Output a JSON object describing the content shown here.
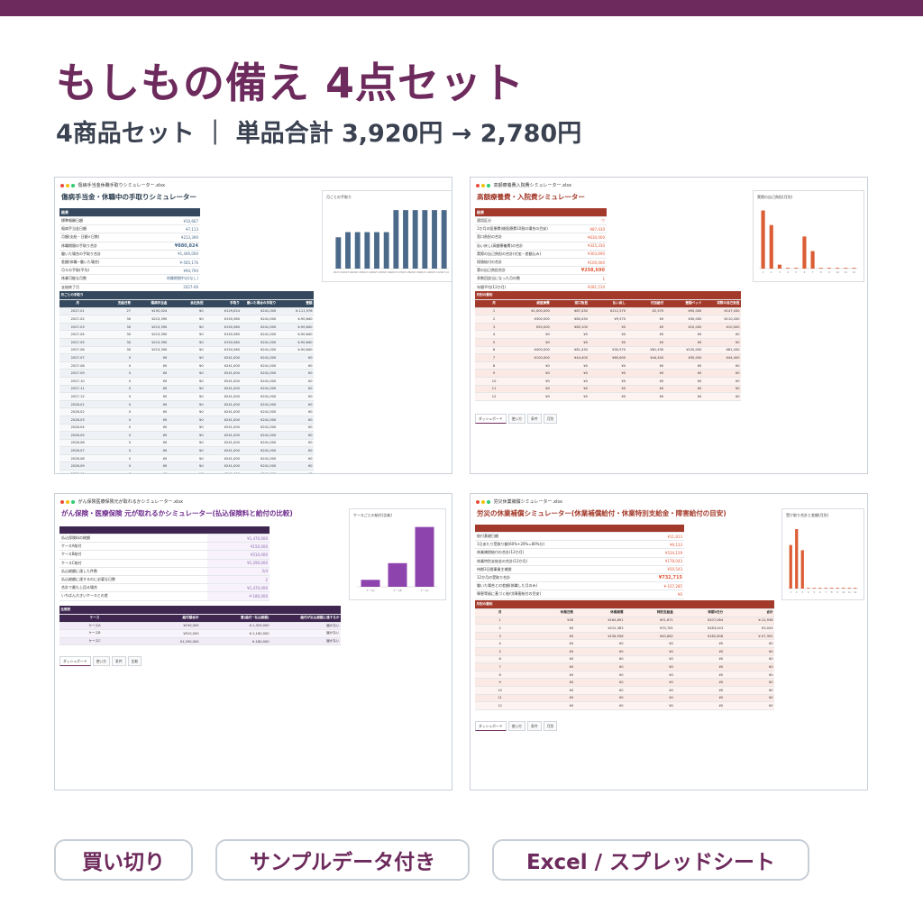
{
  "header": {
    "title": "もしもの備え 4点セット",
    "subtitle": "4商品セット ｜ 単品合計 3,920円 → 2,780円"
  },
  "colors": {
    "brand": "#6d2a5c",
    "navy": "#34495e",
    "brick": "#a3392a",
    "bar_blue": "#4b6a8a",
    "bar_orange": "#dc5c34",
    "purple_dark": "#3e2650",
    "purple_bar": "#8e44ad"
  },
  "tags": [
    "買い切り",
    "サンプルデータ付き",
    "Excel / スプレッドシート"
  ],
  "cards": [
    {
      "file": "傷病手当金休職手取りシミュレーター.xlsx",
      "sheet_title": "傷病手当金・休職中の手取りシミュレーター",
      "summary_label": "結果",
      "kpis": [
        [
          "標準報酬日額",
          "¥10,667"
        ],
        [
          "傷病手当金日額",
          "¥7,113"
        ],
        [
          "月額(支給・日額×日数)",
          "¥213,390"
        ],
        [
          "休職期間の手取り合計",
          "¥880,824"
        ],
        [
          "働いた場合の手取り合計",
          "¥1,446,000"
        ],
        [
          "差額(休職−働いた場合)",
          "¥-565,176"
        ],
        [
          "月々の手取(平均)",
          "¥94,794"
        ],
        [
          "休業可能な月数",
          "休職期間中は(なし)"
        ],
        [
          "支給終了月",
          "2027-06"
        ]
      ],
      "table_label": "月ごとの手取り",
      "columns": [
        "月",
        "支給日数",
        "傷病手当金",
        "会社負担",
        "手取り",
        "働いた場合の手取り",
        "差額"
      ],
      "rows": [
        [
          "2027-01",
          "27",
          "¥192,024",
          "¥0",
          "¥129,024",
          "¥241,000",
          "¥-111,976"
        ],
        [
          "2027-02",
          "30",
          "¥213,390",
          "¥0",
          "¥150,360",
          "¥241,000",
          "¥-90,640"
        ],
        [
          "2027-03",
          "30",
          "¥213,390",
          "¥0",
          "¥150,360",
          "¥241,000",
          "¥-90,640"
        ],
        [
          "2027-04",
          "30",
          "¥213,390",
          "¥0",
          "¥150,360",
          "¥241,000",
          "¥-90,640"
        ],
        [
          "2027-05",
          "30",
          "¥213,390",
          "¥0",
          "¥150,360",
          "¥241,000",
          "¥-90,640"
        ],
        [
          "2027-06",
          "30",
          "¥213,390",
          "¥0",
          "¥150,360",
          "¥241,000",
          "¥-90,640"
        ],
        [
          "2027-07",
          "0",
          "¥0",
          "¥0",
          "¥241,000",
          "¥241,000",
          "¥0"
        ],
        [
          "2027-08",
          "0",
          "¥0",
          "¥0",
          "¥241,000",
          "¥241,000",
          "¥0"
        ],
        [
          "2027-09",
          "0",
          "¥0",
          "¥0",
          "¥241,000",
          "¥241,000",
          "¥0"
        ],
        [
          "2027-10",
          "0",
          "¥0",
          "¥0",
          "¥241,000",
          "¥241,000",
          "¥0"
        ],
        [
          "2027-11",
          "0",
          "¥0",
          "¥0",
          "¥241,000",
          "¥241,000",
          "¥0"
        ],
        [
          "2027-12",
          "0",
          "¥0",
          "¥0",
          "¥241,000",
          "¥241,000",
          "¥0"
        ],
        [
          "2028-01",
          "0",
          "¥0",
          "¥0",
          "¥241,000",
          "¥241,000",
          "¥0"
        ],
        [
          "2028-02",
          "0",
          "¥0",
          "¥0",
          "¥241,000",
          "¥241,000",
          "¥0"
        ],
        [
          "2028-03",
          "0",
          "¥0",
          "¥0",
          "¥241,000",
          "¥241,000",
          "¥0"
        ],
        [
          "2028-04",
          "0",
          "¥0",
          "¥0",
          "¥241,000",
          "¥241,000",
          "¥0"
        ],
        [
          "2028-05",
          "0",
          "¥0",
          "¥0",
          "¥241,000",
          "¥241,000",
          "¥0"
        ],
        [
          "2028-06",
          "0",
          "¥0",
          "¥0",
          "¥241,000",
          "¥241,000",
          "¥0"
        ],
        [
          "2028-07",
          "0",
          "¥0",
          "¥0",
          "¥241,000",
          "¥241,000",
          "¥0"
        ],
        [
          "2028-08",
          "0",
          "¥0",
          "¥0",
          "¥241,000",
          "¥241,000",
          "¥0"
        ],
        [
          "2028-09",
          "0",
          "¥0",
          "¥0",
          "¥241,000",
          "¥241,000",
          "¥0"
        ],
        [
          "2028-10",
          "0",
          "¥0",
          "¥0",
          "¥241,000",
          "¥241,000",
          "¥0"
        ]
      ],
      "chart_title": "月ごとの手取り"
    },
    {
      "file": "高額療養費入院費シミュレーター.xlsx",
      "sheet_title": "高額療養費・入院費シミュレーター",
      "summary_label": "結果",
      "kpis": [
        [
          "適用区分",
          "ウ"
        ],
        [
          "1か月の医療費(総医療費10割の場合の目安)",
          "¥87,430"
        ],
        [
          "窓口負担の合計",
          "¥630,000"
        ],
        [
          "払い戻し(高額療養費)の合計",
          "¥325,330"
        ],
        [
          "実際の自己負担の合計(付加・差額込み)",
          "¥303,690"
        ],
        [
          "保険給付の合計",
          "¥100,000"
        ],
        [
          "実の自己負担合計",
          "¥258,690"
        ],
        [
          "多数回該当になった月の数",
          "1"
        ],
        [
          "年間平均(12か月)",
          "¥281,510"
        ]
      ],
      "table_label": "月別の要約",
      "columns": [
        "月",
        "総医療費",
        "窓口負担",
        "払い戻し",
        "付加給付",
        "差額ベッド",
        "実際の自己負担"
      ],
      "rows": [
        [
          "1",
          "¥1,000,000",
          "¥87,430",
          "¥212,570",
          "¥2,570",
          "¥50,000",
          "¥147,430"
        ],
        [
          "2",
          "¥300,000",
          "¥80,430",
          "¥9,570",
          "¥0",
          "¥30,000",
          "¥110,430"
        ],
        [
          "3",
          "¥50,000",
          "¥80,100",
          "¥0",
          "¥0",
          "¥10,000",
          "¥10,000"
        ],
        [
          "4",
          "¥0",
          "¥0",
          "¥0",
          "¥0",
          "¥0",
          "¥0"
        ],
        [
          "5",
          "¥0",
          "¥0",
          "¥0",
          "¥0",
          "¥0",
          "¥0"
        ],
        [
          "6",
          "¥400,000",
          "¥81,430",
          "¥30,570",
          "¥81,430",
          "¥120,000",
          "¥81,430"
        ],
        [
          "7",
          "¥100,000",
          "¥44,400",
          "¥60,600",
          "¥44,400",
          "¥30,000",
          "¥44,400"
        ],
        [
          "8",
          "¥0",
          "¥0",
          "¥0",
          "¥0",
          "¥0",
          "¥0"
        ],
        [
          "9",
          "¥0",
          "¥0",
          "¥0",
          "¥0",
          "¥0",
          "¥0"
        ],
        [
          "10",
          "¥0",
          "¥0",
          "¥0",
          "¥0",
          "¥0",
          "¥0"
        ],
        [
          "11",
          "¥0",
          "¥0",
          "¥0",
          "¥0",
          "¥0",
          "¥0"
        ],
        [
          "12",
          "¥0",
          "¥0",
          "¥0",
          "¥0",
          "¥0",
          "¥0"
        ]
      ],
      "chart_title": "実際の自己負担(月別)",
      "tabs": [
        "ダッシュボード",
        "使い方",
        "条件",
        "月別"
      ]
    },
    {
      "file": "がん保険医療保険元が取れるかシミュレーター.xlsx",
      "sheet_title": "がん保険・医療保険 元が取れるかシミュレーター(払込保険料と給付の比較)",
      "kpis": [
        [
          "払込保険料の総額",
          "¥1,470,000"
        ],
        [
          "ケースA給付",
          "¥150,000"
        ],
        [
          "ケースB給付",
          "¥510,000"
        ],
        [
          "ケースC給付",
          "¥1,290,000"
        ],
        [
          "払込総額に達した件数",
          "2/4"
        ],
        [
          "払込総額に達するのに必要な日数",
          "2"
        ],
        [
          "合計で最も上回る場合",
          "¥1,470,000"
        ],
        [
          "いちばん大きいケースとの差",
          "¥-180,000"
        ]
      ],
      "table_label": "比較表",
      "columns": [
        "ケース",
        "給付額合計",
        "差(給付−払込総額)",
        "給付が払込総額に達するか"
      ],
      "rows": [
        [
          "ケースA",
          "¥150,000",
          "¥-1,320,000",
          "届かない"
        ],
        [
          "ケースB",
          "¥510,000",
          "¥-1,160,000",
          "届かない"
        ],
        [
          "ケースC",
          "¥1,290,000",
          "¥-180,000",
          "届かない"
        ]
      ],
      "chart_title": "ケースごとの給付(比較)",
      "tabs": [
        "ダッシュボード",
        "使い方",
        "条件",
        "比較"
      ]
    },
    {
      "file": "労災休業補償シミュレーター.xlsx",
      "sheet_title": "労災の休業補償シミュレーター(休業補償給付・休業特別支給金・障害給付の目安)",
      "kpis": [
        [
          "給付基礎日額",
          "¥11,813"
        ],
        [
          "1日あたり受取り額(60%+20%=80%分)",
          "¥9,133"
        ],
        [
          "休業補償給付の合計(12か月)",
          "¥534,129"
        ],
        [
          "休業特別支給金の合計(12か月)",
          "¥178,043"
        ],
        [
          "待期3日間事業主補償",
          "¥20,543"
        ],
        [
          "12か月の受取り合計",
          "¥732,715"
        ],
        [
          "働いた場合との差額(休職した月のみ)",
          "¥-107,285"
        ],
        [
          "障害等級に基づく給付(障害給付の目安)",
          "¥0"
        ]
      ],
      "table_label": "月別の要約",
      "columns": [
        "月",
        "休業日数",
        "休業補償",
        "特別支給金",
        "待期3日分",
        "合計"
      ],
      "rows": [
        [
          "1",
          "¥30",
          "¥164,891",
          "¥51,671",
          "¥207,064",
          "¥-12,936"
        ],
        [
          "2",
          "¥0",
          "¥212,383",
          "¥70,761",
          "¥283,043",
          "¥3,043"
        ],
        [
          "3",
          "¥0",
          "¥156,956",
          "¥40,662",
          "¥182,608",
          "¥-97,392"
        ],
        [
          "4",
          "¥0",
          "¥0",
          "¥0",
          "¥0",
          "¥0"
        ],
        [
          "5",
          "¥0",
          "¥0",
          "¥0",
          "¥0",
          "¥0"
        ],
        [
          "6",
          "¥0",
          "¥0",
          "¥0",
          "¥0",
          "¥0"
        ],
        [
          "7",
          "¥0",
          "¥0",
          "¥0",
          "¥0",
          "¥0"
        ],
        [
          "8",
          "¥0",
          "¥0",
          "¥0",
          "¥0",
          "¥0"
        ],
        [
          "9",
          "¥0",
          "¥0",
          "¥0",
          "¥0",
          "¥0"
        ],
        [
          "10",
          "¥0",
          "¥0",
          "¥0",
          "¥0",
          "¥0"
        ],
        [
          "11",
          "¥0",
          "¥0",
          "¥0",
          "¥0",
          "¥0"
        ],
        [
          "12",
          "¥0",
          "¥0",
          "¥0",
          "¥0",
          "¥0"
        ]
      ],
      "chart_title": "受け取り合計と差額(月別)",
      "tabs": [
        "ダッシュボード",
        "使い方",
        "条件",
        "月別"
      ]
    }
  ],
  "chart_data": [
    {
      "type": "bar",
      "title": "月ごとの手取り",
      "categories": [
        "2027-01",
        "2027-02",
        "2027-03",
        "2027-04",
        "2027-05",
        "2027-06",
        "2027-07",
        "2027-08",
        "2027-09",
        "2027-10",
        "2027-11",
        "2027-12"
      ],
      "values": [
        129024,
        150360,
        150360,
        150360,
        150360,
        150360,
        241000,
        241000,
        241000,
        241000,
        241000,
        241000
      ],
      "ylim": [
        0,
        260000
      ]
    },
    {
      "type": "bar",
      "title": "実際の自己負担(月別)",
      "categories": [
        "1",
        "2",
        "3",
        "4",
        "5",
        "6",
        "7",
        "8",
        "9",
        "10",
        "11",
        "12"
      ],
      "values": [
        147430,
        110430,
        10000,
        0,
        0,
        81430,
        44400,
        0,
        0,
        0,
        0,
        0
      ],
      "ylim": [
        0,
        160000
      ]
    },
    {
      "type": "bar",
      "title": "ケースごとの給付(比較)",
      "categories": [
        "ケースA",
        "ケースB",
        "ケースC"
      ],
      "values": [
        150000,
        510000,
        1290000
      ],
      "ylim": [
        0,
        1400000
      ]
    },
    {
      "type": "bar",
      "title": "受け取り合計と差額(月別)",
      "categories": [
        "1",
        "2",
        "3",
        "4",
        "5",
        "6",
        "7",
        "8",
        "9",
        "10",
        "11",
        "12"
      ],
      "values": [
        207064,
        283043,
        182608,
        0,
        0,
        0,
        0,
        0,
        0,
        0,
        0,
        0
      ],
      "ylim": [
        0,
        300000
      ]
    }
  ]
}
